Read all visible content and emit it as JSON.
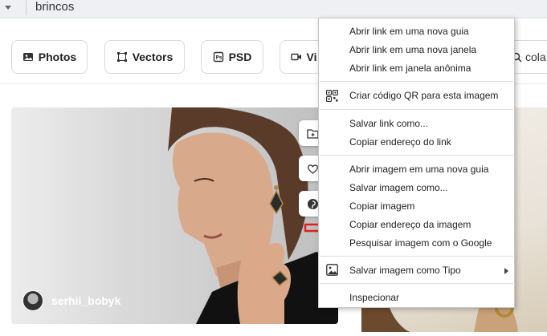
{
  "search": {
    "query": "brincos"
  },
  "filters": [
    {
      "label": "Photos",
      "icon": "image-icon"
    },
    {
      "label": "Vectors",
      "icon": "vector-icon"
    },
    {
      "label": "PSD",
      "icon": "psd-icon"
    },
    {
      "label": "Vi",
      "icon": "video-icon"
    }
  ],
  "search_secondary": {
    "value": "cola"
  },
  "photo": {
    "author": "serhii_bobyk"
  },
  "context_menu": {
    "items": [
      "Abrir link em uma nova guia",
      "Abrir link em uma nova janela",
      "Abrir link em janela anônima",
      "Criar código QR para esta imagem",
      "Salvar link como...",
      "Copiar endereço do link",
      "Abrir imagem em uma nova guia",
      "Salvar imagem como...",
      "Copiar imagem",
      "Copiar endereço da imagem",
      "Pesquisar imagem com o Google",
      "Salvar imagem como Tipo",
      "Inspecionar"
    ]
  },
  "colors": {
    "annotation_arrow": "#e0201e",
    "menu_border": "#c8c8c8"
  }
}
